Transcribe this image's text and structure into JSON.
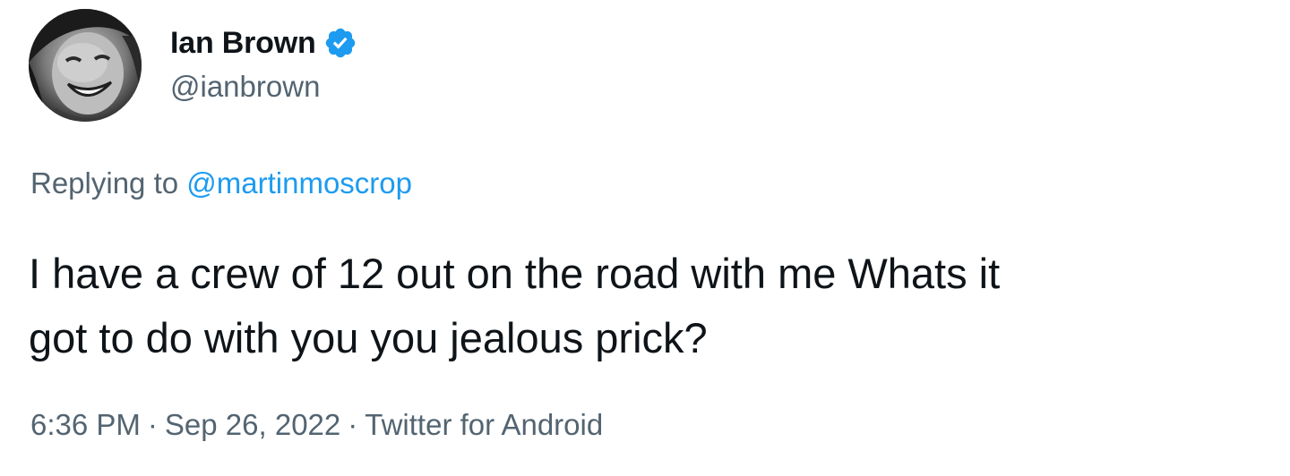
{
  "author": {
    "display_name": "Ian Brown",
    "handle": "@ianbrown",
    "verified": true,
    "verified_icon": "verified-badge-icon"
  },
  "reply": {
    "prefix": "Replying to",
    "handle": "@martinmoscrop"
  },
  "tweet": {
    "text": "I have a crew of 12 out on the road with me Whats it\ngot to do with you you jealous prick?"
  },
  "meta": {
    "time": "6:36 PM",
    "separator": "·",
    "date": "Sep 26, 2022",
    "source": "Twitter for Android"
  },
  "colors": {
    "text_primary": "#0f1419",
    "text_secondary": "#536471",
    "link": "#1d9bf0",
    "verified": "#1d9bf0"
  }
}
